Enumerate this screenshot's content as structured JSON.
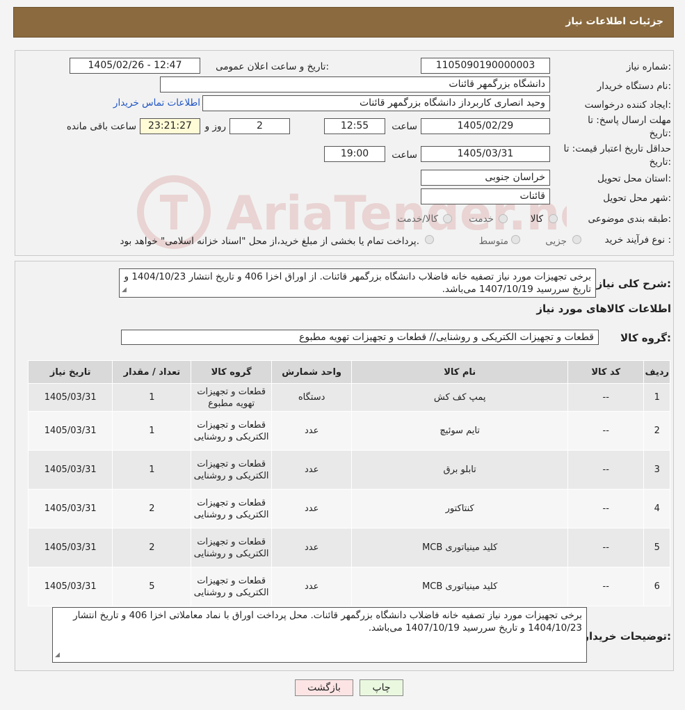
{
  "header": {
    "title": "جزئیات اطلاعات نیاز"
  },
  "form": {
    "need_number_label": "شماره نیاز:",
    "need_number": "1105090190000003",
    "announce_label": "تاریخ و ساعت اعلان عمومی:",
    "announce_value": "1405/02/26 - 12:47",
    "buyer_org_label": "نام دستگاه خریدار:",
    "buyer_org": "دانشگاه بزرگمهر قائنات",
    "creator_label": "ایجاد کننده درخواست:",
    "creator": "وحید انصاری کاربرداز دانشگاه بزرگمهر قائنات",
    "contact_link": "اطلاعات تماس خریدار",
    "deadline_label": "مهلت ارسال پاسخ: تا",
    "deadline_label2": "تاریخ:",
    "deadline_date": "1405/02/29",
    "time_label": "ساعت",
    "deadline_time": "12:55",
    "days_value": "2",
    "days_label": "روز و",
    "remaining_time": "23:21:27",
    "remaining_label": "ساعت باقی مانده",
    "validity_label": "حداقل تاریخ اعتبار قیمت: تا",
    "validity_label2": "تاریخ:",
    "validity_date": "1405/03/31",
    "validity_time_label": "ساعت",
    "validity_time": "19:00",
    "province_label": "استان محل تحویل:",
    "province": "خراسان جنوبی",
    "city_label": "شهر محل تحویل:",
    "city": "قائنات",
    "category_label": "طبقه بندی موضوعی:",
    "category_options": [
      "کالا",
      "خدمت",
      "کالا/خدمت"
    ],
    "process_label": "نوع فرآیند خرید :",
    "process_options": [
      "جزیی",
      "متوسط"
    ],
    "process_note": "پرداخت تمام یا بخشی از مبلغ خرید،از محل \"اسناد خزانه اسلامی\" خواهد بود."
  },
  "summary": {
    "label": "شرح کلی نیاز:",
    "text": "برخی تجهیزات مورد نیاز تصفیه خانه فاضلاب دانشگاه بزرگمهر قائنات. از اوراق اخزا 406 و تاریخ انتشار 1404/10/23 و تاریخ سررسید 1407/10/19 می‌باشد.",
    "goods_info_title": "اطلاعات کالاهای مورد نیاز",
    "goods_group_label": "گروه کالا:",
    "goods_group": "قطعات و تجهیزات الکتریکی و روشنایی//  قطعات و تجهیزات تهویه مطبوع"
  },
  "table": {
    "headers": [
      "ردیف",
      "کد کالا",
      "نام کالا",
      "واحد شمارش",
      "گروه کالا",
      "تعداد / مقدار",
      "تاریخ نیاز"
    ],
    "rows": [
      {
        "row": "1",
        "code": "--",
        "name": "پمپ کف کش",
        "unit": "دستگاه",
        "group": "قطعات و تجهیزات تهویه مطبوع",
        "qty": "1",
        "date": "1405/03/31"
      },
      {
        "row": "2",
        "code": "--",
        "name": "تایم سوئیچ",
        "unit": "عدد",
        "group": "قطعات و تجهیزات الکتریکی و روشنایی",
        "qty": "1",
        "date": "1405/03/31"
      },
      {
        "row": "3",
        "code": "--",
        "name": "تابلو برق",
        "unit": "عدد",
        "group": "قطعات و تجهیزات الکتریکی و روشنایی",
        "qty": "1",
        "date": "1405/03/31"
      },
      {
        "row": "4",
        "code": "--",
        "name": "کنتاکتور",
        "unit": "عدد",
        "group": "قطعات و تجهیزات الکتریکی و روشنایی",
        "qty": "2",
        "date": "1405/03/31"
      },
      {
        "row": "5",
        "code": "--",
        "name": "کلید مینیاتوری MCB",
        "unit": "عدد",
        "group": "قطعات و تجهیزات الکتریکی و روشنایی",
        "qty": "2",
        "date": "1405/03/31"
      },
      {
        "row": "6",
        "code": "--",
        "name": "کلید مینیاتوری MCB",
        "unit": "عدد",
        "group": "قطعات و تجهیزات الکتریکی و روشنایی",
        "qty": "5",
        "date": "1405/03/31"
      }
    ]
  },
  "buyer_notes": {
    "label": "توضیحات خریدار:",
    "text": "برخی تجهیزات مورد نیاز تصفیه خانه فاضلاب دانشگاه بزرگمهر قائنات. محل پرداخت اوراق با نماد معاملاتی اخزا 406 و تاریخ انتشار 1404/10/23 و تاریخ سررسید 1407/10/19 می‌باشد."
  },
  "buttons": {
    "back": "بازگشت",
    "print": "چاپ"
  },
  "watermark": "AriaTender.neT"
}
